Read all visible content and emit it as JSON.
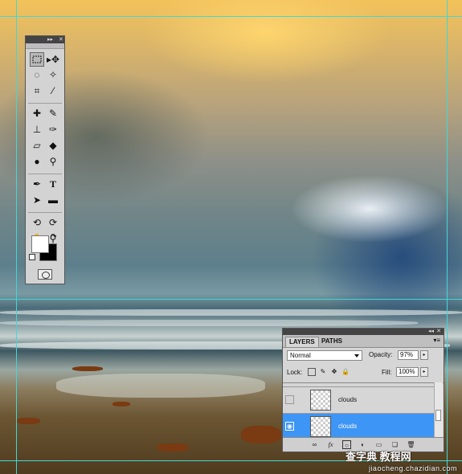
{
  "tools_panel": {
    "header_icons": [
      "collapse-arrows-icon",
      "close-icon"
    ],
    "tools": [
      [
        "rectangular-marquee-icon",
        "move-icon"
      ],
      [
        "lasso-icon",
        "magic-wand-icon"
      ],
      [
        "crop-icon",
        "eyedropper-icon"
      ],
      [
        "healing-brush-icon",
        "brush-icon"
      ],
      [
        "clone-stamp-icon",
        "history-brush-icon"
      ],
      [
        "eraser-icon",
        "paint-bucket-icon"
      ],
      [
        "blur-icon",
        "dodge-icon"
      ],
      [
        "pen-icon",
        "type-icon"
      ],
      [
        "path-selection-icon",
        "rectangle-shape-icon"
      ],
      [
        "3d-rotate-icon",
        "3d-orbit-icon"
      ],
      [
        "hand-icon",
        "zoom-icon"
      ]
    ],
    "foreground_color": "#ffffff",
    "background_color": "#000000"
  },
  "layers_panel": {
    "tabs": [
      "LAYERS",
      "PATHS"
    ],
    "blend_mode": "Normal",
    "opacity_label": "Opacity:",
    "opacity_value": "97%",
    "lock_label": "Lock:",
    "fill_label": "Fill:",
    "fill_value": "100%",
    "layers": [
      {
        "name": "clouds",
        "visible": false,
        "selected": false
      },
      {
        "name": "clouds",
        "visible": true,
        "selected": true
      }
    ],
    "bottom_icons": [
      "link-icon",
      "fx-icon",
      "mask-icon",
      "adjustment-icon",
      "group-icon",
      "new-layer-icon",
      "trash-icon"
    ]
  },
  "watermark": {
    "site_text": "查字典 教程网",
    "url_text": "jiaocheng.chazidian.com"
  },
  "colors": {
    "guide": "#3fd8d8",
    "selection": "#3d95f5"
  }
}
